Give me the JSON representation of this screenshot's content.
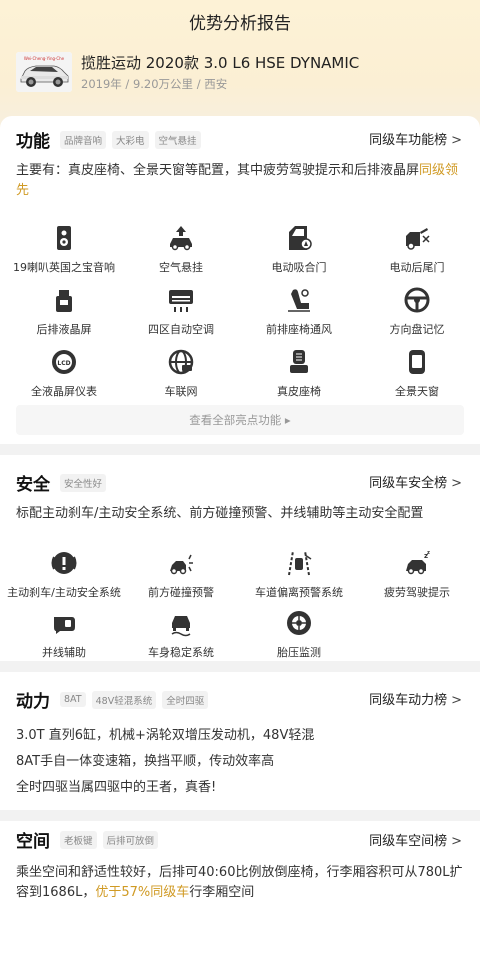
{
  "header": {
    "title": "优势分析报告"
  },
  "car": {
    "name": "揽胜运动 2020款 3.0 L6 HSE DYNAMIC",
    "meta": "2019年 / 9.20万公里 / 西安",
    "thumb_text": "Wei·Cheng·Ying·Che"
  },
  "features": {
    "title": "功能",
    "tags": [
      "品牌音响",
      "大彩电",
      "空气悬挂"
    ],
    "rank_label": "同级车功能榜",
    "desc_main": "主要有：真皮座椅、全景天窗等配置，其中疲劳驾驶提示和后排液晶屏",
    "desc_highlight": "同级领先",
    "items": [
      {
        "label": "19喇叭英国之宝音响",
        "icon": "speaker-icon"
      },
      {
        "label": "空气悬挂",
        "icon": "air-suspension-icon"
      },
      {
        "label": "电动吸合门",
        "icon": "soft-close-door-icon"
      },
      {
        "label": "电动后尾门",
        "icon": "power-tailgate-icon"
      },
      {
        "label": "后排液晶屏",
        "icon": "rear-screen-icon"
      },
      {
        "label": "四区自动空调",
        "icon": "climate-control-icon"
      },
      {
        "label": "前排座椅通风",
        "icon": "seat-ventilation-icon"
      },
      {
        "label": "方向盘记忆",
        "icon": "steering-wheel-icon"
      },
      {
        "label": "全液晶屏仪表",
        "icon": "lcd-gauge-icon"
      },
      {
        "label": "车联网",
        "icon": "connected-car-icon"
      },
      {
        "label": "真皮座椅",
        "icon": "leather-seat-icon"
      },
      {
        "label": "全景天窗",
        "icon": "panoramic-sunroof-icon"
      }
    ],
    "view_all_label": "查看全部亮点功能 ▸"
  },
  "safety": {
    "title": "安全",
    "tags": [
      "安全性好"
    ],
    "rank_label": "同级车安全榜",
    "desc": "标配主动刹车/主动安全系统、前方碰撞预警、并线辅助等主动安全配置",
    "items": [
      {
        "label": "主动刹车/主动安全系统",
        "icon": "active-brake-icon"
      },
      {
        "label": "前方碰撞预警",
        "icon": "collision-warning-icon"
      },
      {
        "label": "车道偏离预警系统",
        "icon": "lane-departure-icon"
      },
      {
        "label": "疲劳驾驶提示",
        "icon": "fatigue-alert-icon"
      },
      {
        "label": "并线辅助",
        "icon": "blind-spot-icon"
      },
      {
        "label": "车身稳定系统",
        "icon": "stability-control-icon"
      },
      {
        "label": "胎压监测",
        "icon": "tire-pressure-icon"
      }
    ]
  },
  "power": {
    "title": "动力",
    "tags": [
      "8AT",
      "48V轻混系统",
      "全时四驱"
    ],
    "rank_label": "同级车动力榜",
    "lines": [
      "3.0T 直列6缸，机械+涡轮双增压发动机，48V轻混",
      "8AT手自一体变速箱，换挡平顺，传动效率高",
      "全时四驱当属四驱中的王者，真香!"
    ]
  },
  "space": {
    "title": "空间",
    "tags": [
      "老板键",
      "后排可放倒"
    ],
    "rank_label": "同级车空间榜",
    "desc_main": "乘坐空间和舒适性较好，后排可40:60比例放倒座椅，行李厢容积可从780L扩容到1686L，",
    "desc_highlight": "优于57%同级车",
    "desc_tail": "行李厢空间"
  },
  "colors": {
    "accent": "#d09a24",
    "icon": "#333333"
  }
}
